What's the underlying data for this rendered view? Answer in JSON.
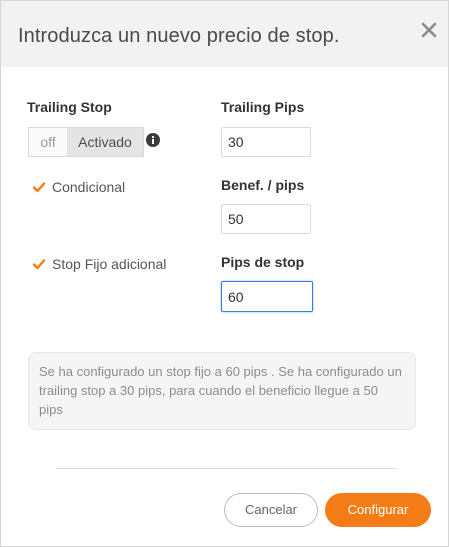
{
  "dialog": {
    "title": "Introduzca un nuevo precio de stop."
  },
  "trailing_stop": {
    "label": "Trailing Stop",
    "toggle_off": "off",
    "toggle_on": "Activado",
    "state": "on"
  },
  "conditional": {
    "label": "Condicional",
    "checked": true
  },
  "fixed_stop": {
    "label": "Stop Fijo adicional",
    "checked": true
  },
  "fields": {
    "trailing_pips_label": "Trailing Pips",
    "trailing_pips_value": "30",
    "profit_pips_label": "Benef. / pips",
    "profit_pips_value": "50",
    "stop_pips_label": "Pips de stop",
    "stop_pips_value": "60"
  },
  "note": {
    "text": "Se ha configurado un stop fijo a 60 pips . Se ha configurado un trailing stop a 30 pips, para cuando el beneficio llegue a 50 pips"
  },
  "buttons": {
    "cancel": "Cancelar",
    "confirm": "Configurar"
  },
  "colors": {
    "accent": "#f47c16",
    "focus": "#3b7bd9"
  },
  "icons": {
    "close": "close-icon",
    "info": "info-icon",
    "checkbox": "checkmark-icon"
  }
}
